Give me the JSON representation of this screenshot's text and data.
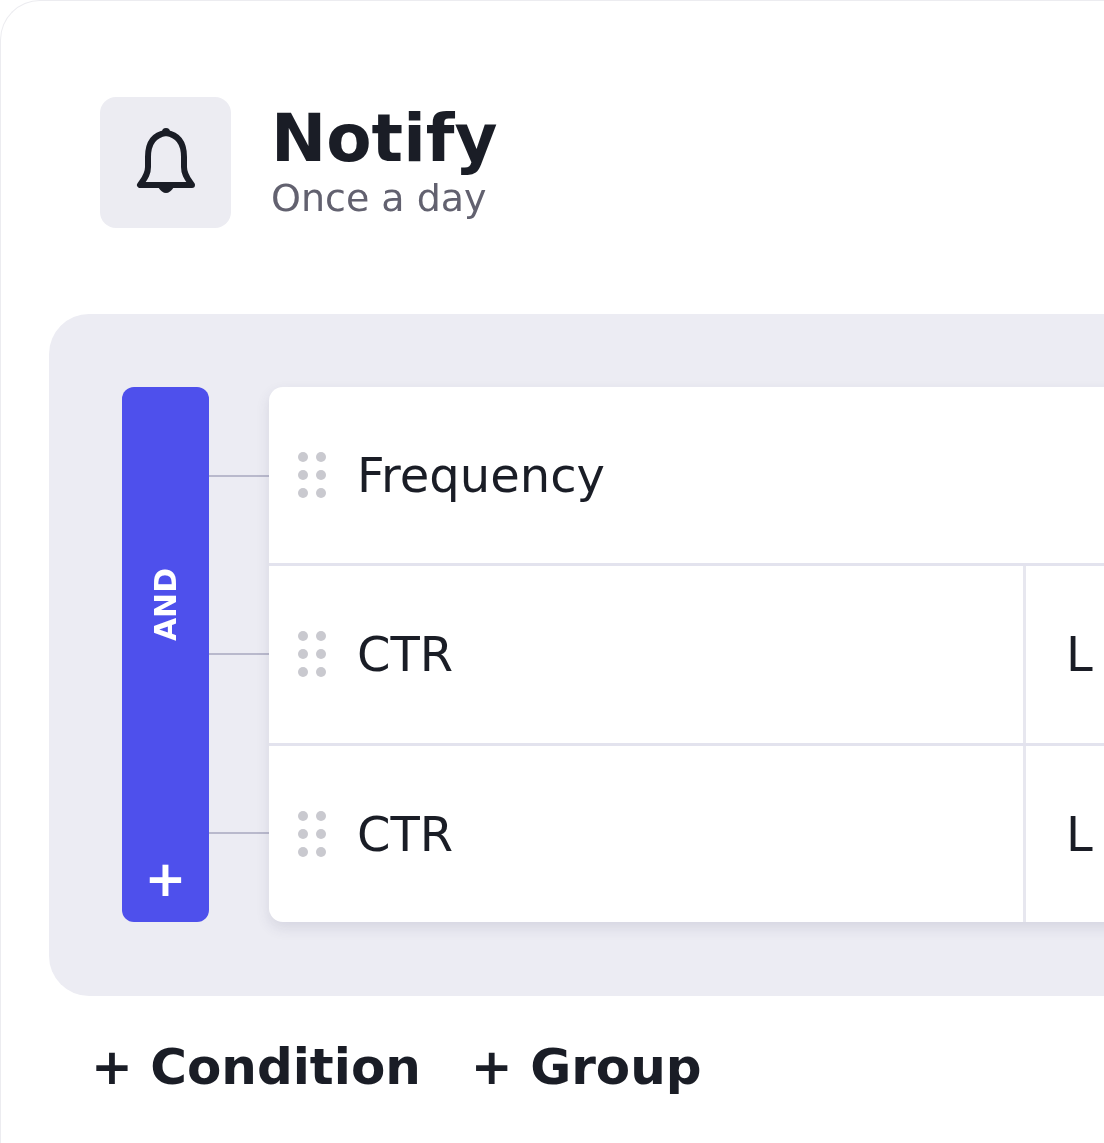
{
  "header": {
    "title": "Notify",
    "subtitle": "Once a day"
  },
  "group": {
    "operator": "AND",
    "add_label": "+"
  },
  "conditions": [
    {
      "kind": "single",
      "field": "Frequency"
    },
    {
      "kind": "split",
      "field": "CTR",
      "column_2": "L"
    },
    {
      "kind": "split",
      "field": "CTR",
      "column_2": "L"
    }
  ],
  "actions": [
    "+ Condition",
    "+ Group"
  ]
}
